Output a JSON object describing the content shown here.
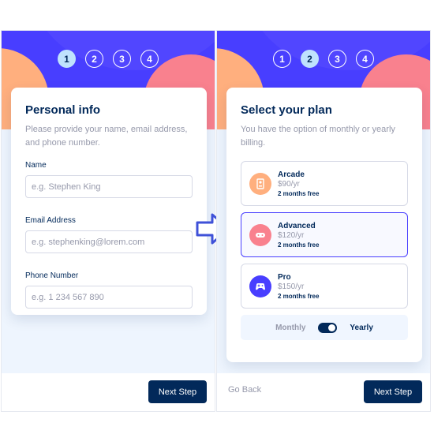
{
  "steps": [
    "1",
    "2",
    "3",
    "4"
  ],
  "personal_info": {
    "title": "Personal info",
    "description": "Please provide your name, email address, and phone number.",
    "fields": [
      {
        "label": "Name",
        "placeholder": "e.g. Stephen King"
      },
      {
        "label": "Email Address",
        "placeholder": "e.g. stephenking@lorem.com"
      },
      {
        "label": "Phone Number",
        "placeholder": "e.g. 1 234 567 890"
      }
    ],
    "next_label": "Next Step"
  },
  "select_plan": {
    "title": "Select your plan",
    "description": "You have the option of monthly or yearly billing.",
    "plans": [
      {
        "name": "Arcade",
        "price": "$90/yr",
        "bonus": "2 months free",
        "icon": "arcade-icon",
        "color": "#ffaf7e"
      },
      {
        "name": "Advanced",
        "price": "$120/yr",
        "bonus": "2 months free",
        "icon": "gamepad-icon",
        "color": "#f9818e"
      },
      {
        "name": "Pro",
        "price": "$150/yr",
        "bonus": "2 months free",
        "icon": "controller-icon",
        "color": "#483eff"
      }
    ],
    "selected_plan": "Advanced",
    "billing": {
      "monthly": "Monthly",
      "yearly": "Yearly",
      "selected": "Yearly"
    },
    "back_label": "Go Back",
    "next_label": "Next Step"
  },
  "colors": {
    "purple": "#483eff",
    "navy": "#02295a",
    "orange": "#ffaf7e",
    "pink": "#f9818e",
    "light_blue": "#bfe2fd",
    "gray": "#9699ab"
  }
}
